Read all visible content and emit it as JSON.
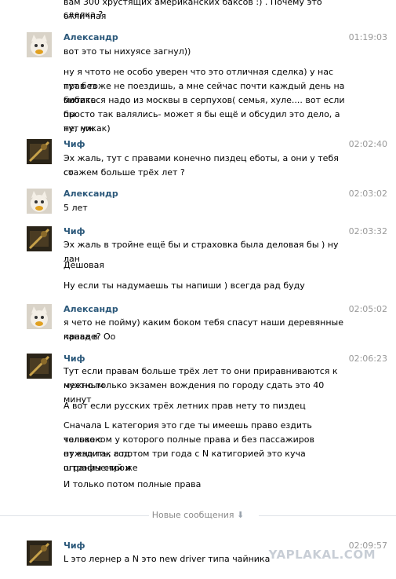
{
  "top_fragment": {
    "lines": [
      "вам 300 хрустящих американских баксов :) . Почему это отличная",
      "сделка ?"
    ]
  },
  "messages": [
    {
      "author": "Александр",
      "time": "01:19:03",
      "avatar": "cat-avatar",
      "paragraphs": [
        [
          "вот это ты нихуясе загнул))"
        ],
        [
          "ну я чтото не особо уверен что это отличная сделка) у нас тут без",
          "прав тоже не поездишь, а мне сейчас почти каждый день на бибике",
          "мотаться надо из москвы в серпухов( семья, хуле.... вот если бы",
          "просто так валялись- может я бы ещё и обсудил это дело, а тут уж",
          "не, никак)"
        ]
      ]
    },
    {
      "author": "Чиф",
      "time": "02:02:40",
      "avatar": "dark-avatar",
      "paragraphs": [
        [
          "Эх жаль, тут с правами конечно пиздец еботы, а они у тебя со",
          "стажем больше трёх лет ?"
        ]
      ]
    },
    {
      "author": "Александр",
      "time": "02:03:02",
      "avatar": "cat-avatar",
      "paragraphs": [
        [
          "5 лет"
        ]
      ]
    },
    {
      "author": "Чиф",
      "time": "02:03:32",
      "avatar": "dark-avatar",
      "paragraphs": [
        [
          "Эх жаль в тройне ещё бы и страховка была деловая бы ) ну лан"
        ],
        [
          "Дешовая"
        ],
        [
          "Ну если ты надумаешь ты напиши ) всегда рад буду"
        ]
      ]
    },
    {
      "author": "Александр",
      "time": "02:05:02",
      "avatar": "cat-avatar",
      "paragraphs": [
        [
          "я чето не пойму) каким боком тебя спасут наши деревянные права в",
          "канаде? Оо"
        ]
      ]
    },
    {
      "author": "Чиф",
      "time": "02:06:23",
      "avatar": "dark-avatar",
      "paragraphs": [
        [
          "Тут если правам больше трёх лет то они приравниваются к местным",
          "нужно только экзамен вождения по городу сдать это 40 минут"
        ],
        [
          "А вот если русских трёх летних прав нету то пиздец"
        ],
        [
          "Сначала L категория это где ты имеешь право ездить только с",
          "человеком у которого полные права и без пассажиров нужно так год",
          "от ездить, а потом три года с N катигорией это куча ограничений и",
          "штрафы строже"
        ],
        [
          "И только потом полные права"
        ]
      ]
    },
    {
      "author": "Чиф",
      "time": "02:09:57",
      "avatar": "dark-avatar",
      "paragraphs": [
        [
          "L это лернер а N это new driver типа чайника"
        ]
      ]
    }
  ],
  "divider": {
    "label": "Новые сообщения",
    "icon": "arrow-down-icon"
  },
  "watermark": {
    "text": "YAPLAKAL.COM"
  }
}
